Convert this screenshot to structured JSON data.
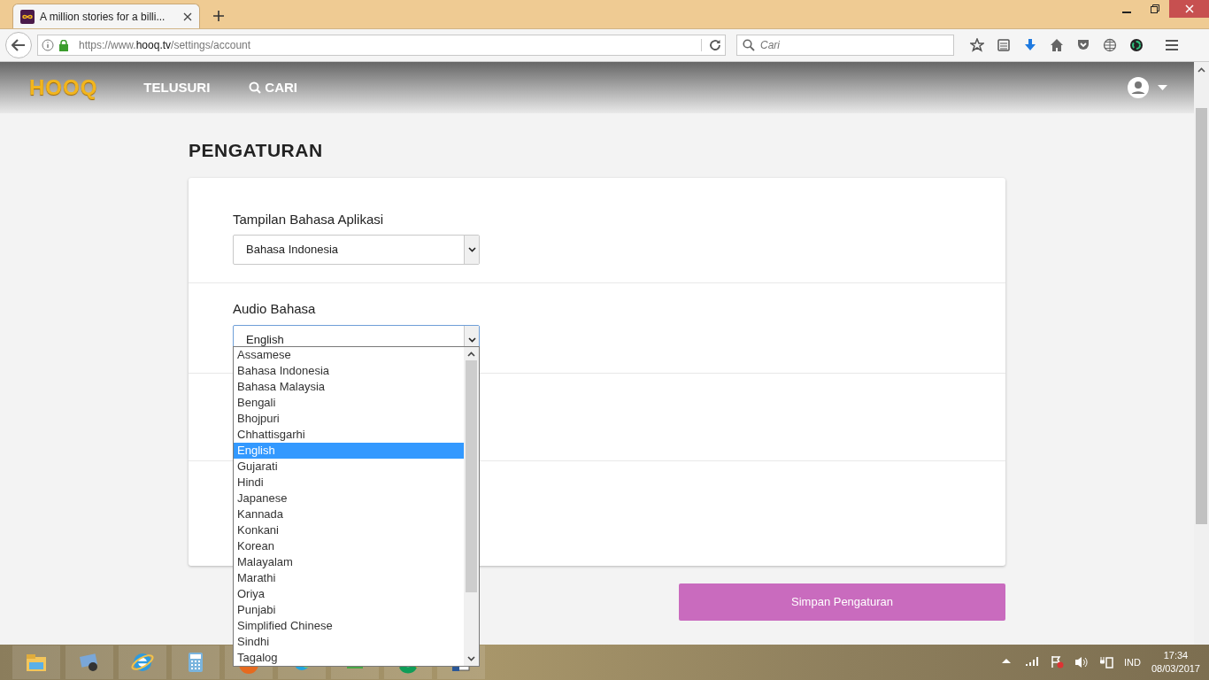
{
  "browser": {
    "tab_title": "A million stories for a billi...",
    "url_prefix": "https://www.",
    "url_host": "hooq.tv",
    "url_path": "/settings/account",
    "search_placeholder": "Cari"
  },
  "navbar": {
    "logo": "HOOQ",
    "links": [
      {
        "label": "TELUSURI",
        "kind": "text"
      },
      {
        "label": "CARI",
        "kind": "search"
      }
    ]
  },
  "page_title": "PENGATURAN",
  "settings": [
    {
      "label": "Tampilan Bahasa Aplikasi",
      "value": "Bahasa Indonesia",
      "focused": false
    },
    {
      "label": "Audio Bahasa",
      "value": "English",
      "focused": true
    }
  ],
  "dropdown": {
    "options": [
      {
        "label": "Assamese",
        "selected": false
      },
      {
        "label": "Bahasa Indonesia",
        "selected": false
      },
      {
        "label": "Bahasa Malaysia",
        "selected": false
      },
      {
        "label": "Bengali",
        "selected": false
      },
      {
        "label": "Bhojpuri",
        "selected": false
      },
      {
        "label": "Chhattisgarhi",
        "selected": false
      },
      {
        "label": "English",
        "selected": true
      },
      {
        "label": "Gujarati",
        "selected": false
      },
      {
        "label": "Hindi",
        "selected": false
      },
      {
        "label": "Japanese",
        "selected": false
      },
      {
        "label": "Kannada",
        "selected": false
      },
      {
        "label": "Konkani",
        "selected": false
      },
      {
        "label": "Korean",
        "selected": false
      },
      {
        "label": "Malayalam",
        "selected": false
      },
      {
        "label": "Marathi",
        "selected": false
      },
      {
        "label": "Oriya",
        "selected": false
      },
      {
        "label": "Punjabi",
        "selected": false
      },
      {
        "label": "Simplified Chinese",
        "selected": false
      },
      {
        "label": "Sindhi",
        "selected": false
      },
      {
        "label": "Tagalog",
        "selected": false
      }
    ]
  },
  "save_button": "Simpan Pengaturan",
  "taskbar": {
    "language": "IND",
    "time": "17:34",
    "date": "08/03/2017"
  }
}
